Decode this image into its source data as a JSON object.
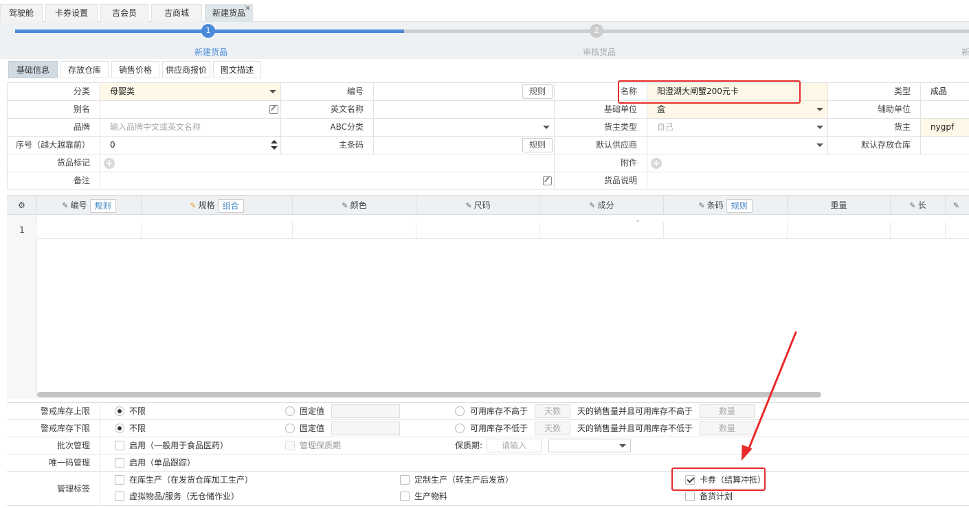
{
  "tabs": [
    {
      "label": "驾驶舱"
    },
    {
      "label": "卡券设置"
    },
    {
      "label": "吉会员"
    },
    {
      "label": "吉商城"
    },
    {
      "label": "新建货品",
      "close": "×"
    }
  ],
  "steps": [
    {
      "num": "1",
      "label": "新建货品"
    },
    {
      "num": "2",
      "label": "审核货品"
    },
    {
      "label": "新"
    }
  ],
  "subtabs": [
    "基础信息",
    "存放仓库",
    "销售价格",
    "供应商报价",
    "图文描述"
  ],
  "form": {
    "category_label": "分类",
    "category_value": "母婴类",
    "code_label": "编号",
    "rule_btn": "规则",
    "name_label": "名称",
    "name_value": "阳澄湖大闸蟹200元卡",
    "type_label": "类型",
    "type_value": "成品",
    "alias_label": "别名",
    "en_name_label": "英文名称",
    "base_unit_label": "基础单位",
    "base_unit_value": "盒",
    "aux_unit_label": "辅助单位",
    "brand_label": "品牌",
    "brand_placeholder": "输入品牌中文或英文名称",
    "abc_label": "ABC分类",
    "owner_type_label": "货主类型",
    "owner_type_value": "自己",
    "owner_label": "货主",
    "owner_value": "nygpf",
    "seq_label": "序号（越大越靠前）",
    "seq_value": "0",
    "barcode_label": "主条码",
    "supplier_label": "默认供应商",
    "warehouse_label": "默认存放仓库",
    "mark_label": "货品标记",
    "attach_label": "附件",
    "remark_label": "备注",
    "desc_label": "货品说明"
  },
  "grid": {
    "headers": [
      "编号",
      "规格",
      "颜色",
      "尺码",
      "成分",
      "条码",
      "重量",
      "长"
    ],
    "rule_btn": "规则",
    "combo_btn": "组合",
    "row_num": "1"
  },
  "bottom": {
    "stock_upper_label": "警戒库存上限",
    "stock_lower_label": "警戒库存下限",
    "unlimited": "不限",
    "fixed": "固定值",
    "avail_not_higher": "可用库存不高于",
    "avail_not_lower": "可用库存不低于",
    "days_placeholder": "天数",
    "sales_and_not_higher": "天的销售量并且可用库存不高于",
    "sales_and_not_lower": "天的销售量并且可用库存不低于",
    "qty_placeholder": "数量",
    "batch_label": "批次管理",
    "batch_enable": "启用（一般用于食品医药）",
    "shelf_manage": "管理保质期",
    "shelf_label": "保质期:",
    "shelf_placeholder": "请输入",
    "unique_label": "唯一码管理",
    "unique_enable": "启用（单品跟踪）",
    "tag_label": "管理标签",
    "tag_in_stock": "在库生产（在发货仓库加工生产）",
    "tag_custom": "定制生产（转生产后发货）",
    "tag_card": "卡券（结算冲抵）",
    "tag_virtual": "虚拟物品/服务（无仓储作业）",
    "tag_material": "生产物料",
    "tag_stock_plan": "备货计划"
  },
  "colors": {
    "accent": "#4a8ad8",
    "highlight": "#e82a2a",
    "yellow_field": "#fff8e8"
  }
}
